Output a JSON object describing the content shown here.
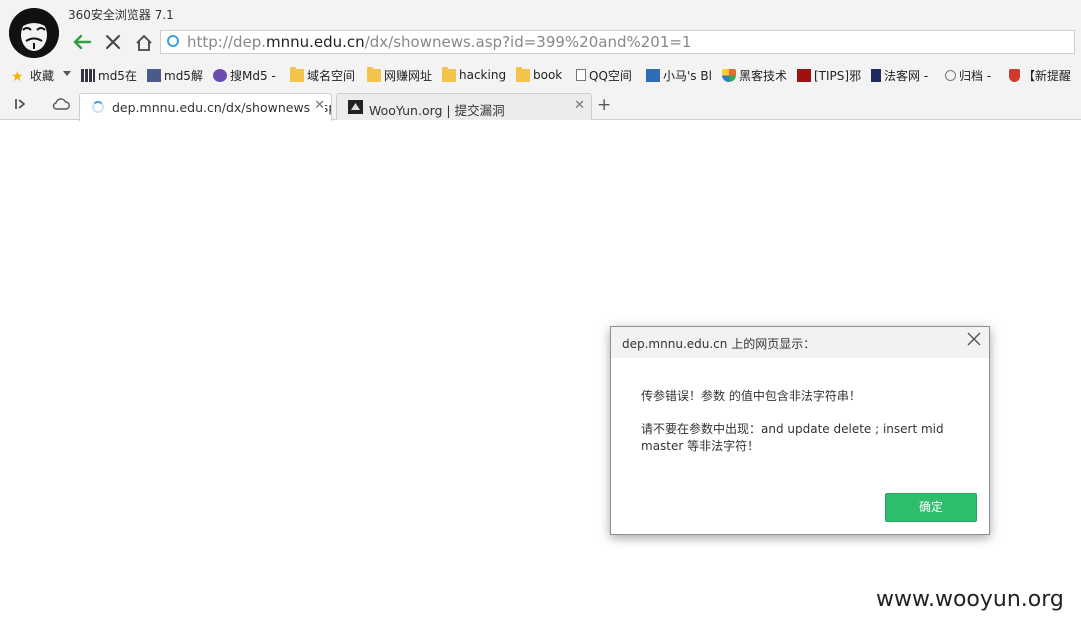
{
  "app": {
    "title": "360安全浏览器 7.1"
  },
  "address_bar": {
    "url_prefix": "http://dep.",
    "url_domain": "mnnu.edu.cn",
    "url_path": "/dx/shownews.asp?id=399%20and%201=1"
  },
  "bookmarks": [
    {
      "label": "收藏",
      "icon": "star-add-icon"
    },
    {
      "label": "md5在",
      "icon": "grid-icon"
    },
    {
      "label": "md5解",
      "icon": "pmd5-icon"
    },
    {
      "label": "搜Md5 -",
      "icon": "cmd5-icon"
    },
    {
      "label": "域名空间",
      "icon": "folder-icon"
    },
    {
      "label": "网赚网址",
      "icon": "folder-icon"
    },
    {
      "label": "hacking",
      "icon": "folder-icon"
    },
    {
      "label": "book",
      "icon": "folder-icon"
    },
    {
      "label": "QQ空间",
      "icon": "page-icon"
    },
    {
      "label": "小马's Bl",
      "icon": "site-icon"
    },
    {
      "label": "黑客技术",
      "icon": "shield-icon"
    },
    {
      "label": "[TIPS]邪",
      "icon": "tips-icon"
    },
    {
      "label": "法客网 -",
      "icon": "forum-icon"
    },
    {
      "label": "归档 -",
      "icon": "archive-icon"
    },
    {
      "label": "【新提醒",
      "icon": "alert-icon"
    }
  ],
  "tabs": [
    {
      "label": "dep.mnnu.edu.cn/dx/shownews.asp",
      "active": true
    },
    {
      "label": "WooYun.org | 提交漏洞",
      "active": false
    }
  ],
  "dialog": {
    "title": "dep.mnnu.edu.cn 上的网页显示：",
    "line1": "传参错误！参数  的值中包含非法字符串！",
    "line2": "请不要在参数中出现：and update delete ; insert mid master 等非法字符！",
    "ok_label": "确定"
  },
  "watermark": "www.wooyun.org",
  "colors": {
    "accent_green": "#2ebd6b",
    "loading_blue": "#3ea0e0"
  }
}
